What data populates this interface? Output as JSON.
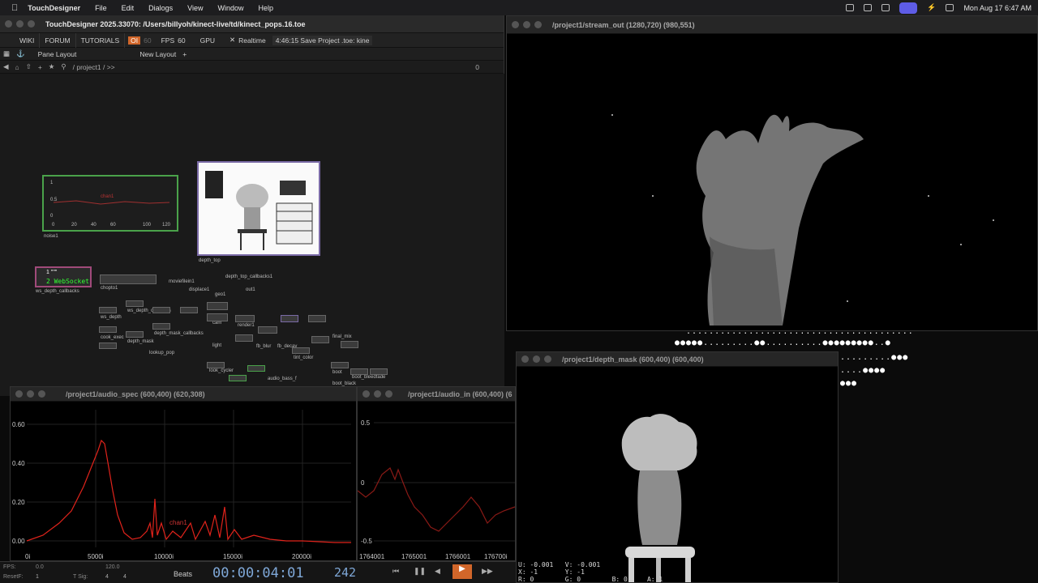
{
  "menubar": {
    "app": "TouchDesigner",
    "items": [
      "File",
      "Edit",
      "Dialogs",
      "View",
      "Window",
      "Help"
    ],
    "clock": "Mon Aug 17  6:47 AM"
  },
  "main_window": {
    "title": "TouchDesigner 2025.33070: /Users/billyoh/kinect-live/td/kinect_pops.16.toe",
    "toolbar": {
      "wiki": "WIKI",
      "forum": "FORUM",
      "tutorials": "TUTORIALS",
      "oi": "OI",
      "oi_num": "60",
      "fps_label": "FPS",
      "fps_value": "60",
      "gpu": "GPU",
      "realtime": "Realtime",
      "status": "4:46:15 Save Project .toe: kine"
    },
    "pane_layout": "Pane Layout",
    "new_layout": "New Layout",
    "path": "/ project1 / >>",
    "pane_index": "0"
  },
  "network": {
    "noise_node": {
      "label": "noise1",
      "chan": "chan1",
      "ticks": [
        "0",
        "20",
        "40",
        "60",
        "100",
        "120"
      ],
      "yvals": [
        "1",
        "0.5",
        "0"
      ]
    },
    "depth_top": {
      "label": "depth_top"
    },
    "webserver": {
      "label": "ws_depth_callbacks",
      "line1": "1  \"\"\"",
      "line2": "2  WebSocket"
    },
    "chopto": {
      "label": "chopto1"
    },
    "small_labels": [
      "depth_top_callbacks1",
      "moviefilein1",
      "displace1",
      "geo1",
      "out1",
      "ws_depth",
      "ws_depth_callbacks",
      "depth_mask_callbacks",
      "render1",
      "cam",
      "light",
      "final_mix",
      "tint_color",
      "cook_exec",
      "depth_mask",
      "lookup_pop",
      "fb_blur",
      "fb_decay",
      "look_cycler",
      "audio_bass_f",
      "boot",
      "boot_bleedfade",
      "boot_black"
    ]
  },
  "stream_window": {
    "title": "/project1/stream_out (1280,720) (980,551)"
  },
  "depth_mask_window": {
    "title": "/project1/depth_mask (600,400) (600,400)",
    "readout_line1": "U: -0.001   V: -0.001",
    "readout_line2": "X: -1       Y: -1",
    "readout_line3": "R: 0        G: 0        B: 0     A: 1"
  },
  "audio_spec_window": {
    "title": "/project1/audio_spec (600,400) (620,308)",
    "yticks": [
      "0.60",
      "0.40",
      "0.20",
      "0.00"
    ],
    "xticks": [
      "0i",
      "5000i",
      "10000i",
      "15000i",
      "20000i"
    ],
    "chan": "chan1"
  },
  "audio_in_window": {
    "title": "/project1/audio_in (600,400) (6",
    "yticks": [
      "0.5",
      "0",
      "-0.5"
    ],
    "xticks": [
      "1764001",
      "1765001",
      "1766001",
      "176700i"
    ]
  },
  "timeline": {
    "fps_label": "FPS:",
    "fps_val": "0.0",
    "resetf": "ResetF:",
    "resetf_val": "1",
    "tsig": "T Sig:",
    "tsig_a": "4",
    "tsig_b": "4",
    "tempo": "120.0",
    "beats": "Beats",
    "timecode": "00:00:04:01",
    "frame": "242"
  },
  "colors": {
    "accent_orange": "#d1662a",
    "spectrum": "#e0231b",
    "menubar_active": "#5e5ce6"
  }
}
